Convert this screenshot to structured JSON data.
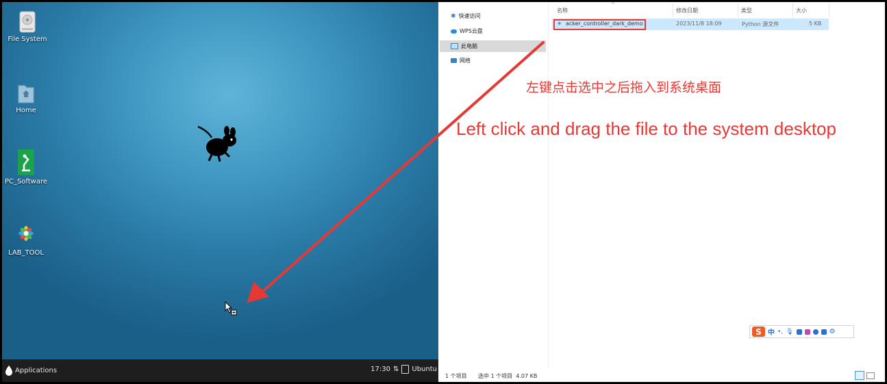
{
  "desktop": {
    "icons": [
      {
        "label": "File System",
        "icon": "drive-icon"
      },
      {
        "label": "Home",
        "icon": "home-folder-icon"
      },
      {
        "label": "PC_Software",
        "icon": "robot-arm-icon"
      },
      {
        "label": "LAB_TOOL",
        "icon": "lab-flower-icon"
      }
    ],
    "taskbar": {
      "applications_label": "Applications",
      "clock": "17:30",
      "user": "Ubuntu"
    }
  },
  "explorer": {
    "nav": [
      {
        "label": "快速访问",
        "icon": "pin-icon"
      },
      {
        "label": "WPS云盘",
        "icon": "cloud-icon"
      },
      {
        "label": "此电脑",
        "icon": "computer-icon",
        "selected": true
      },
      {
        "label": "网络",
        "icon": "network-icon"
      }
    ],
    "columns": {
      "name": "名称",
      "modified": "修改日期",
      "type": "类型",
      "size": "大小"
    },
    "files": [
      {
        "name": "acker_controller_dark_demo",
        "modified": "2023/11/8 18:09",
        "type": "Python 源文件",
        "size": "5 KB",
        "selected": true
      }
    ],
    "status": {
      "item_count": "1 个项目",
      "selection": "选中 1 个项目  4.07 KB"
    },
    "ime": {
      "logo": "S",
      "mode": "中"
    }
  },
  "annotations": {
    "instruction_cn": "左键点击选中之后拖入到系统桌面",
    "instruction_en": "Left click and drag the file to the system desktop",
    "color": "#e53935"
  }
}
